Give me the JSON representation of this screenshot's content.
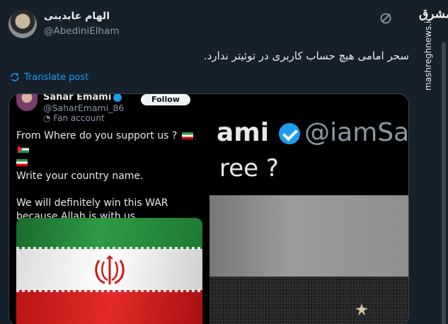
{
  "tweet": {
    "author_name": "الهام عابدینی",
    "handle": "@AbediniElham",
    "text": "سحر امامی هیچ حساب کاربری در توئیتر ندارد.",
    "translate_label": "Translate post"
  },
  "watermark": {
    "logo": "مشرق",
    "site": "mashreghnews.ir"
  },
  "embedded_tweet": {
    "name": "Sahar Emami",
    "handle": "@SaharEmami_86",
    "badge": "Fan account",
    "follow_label": "Follow",
    "line1": "From Where do you support us ?",
    "line2": "Write your country name.",
    "line3": "We will definitely win this WAR because Allah is with us."
  },
  "cropped_tweet": {
    "name_fragment": "ami",
    "handle_fragment": "@iamSaha",
    "text_fragment": "ree ?"
  },
  "colors": {
    "background": "#15202b",
    "accent": "#1d9bf0",
    "text": "#e7e9ea",
    "muted": "#8b98a5"
  },
  "icons": {
    "grok": "grok-icon",
    "translate": "translate-icon",
    "verified": "verified-badge-icon"
  }
}
